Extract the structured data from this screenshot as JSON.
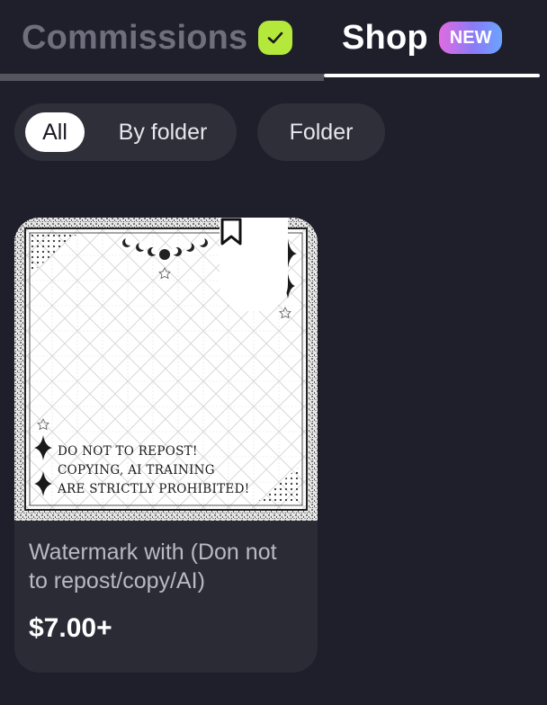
{
  "tabs": {
    "commissions": {
      "label": "Commissions",
      "icon": "check-icon",
      "badge_color": "#b4e83a"
    },
    "shop": {
      "label": "Shop",
      "badge": "NEW"
    }
  },
  "filters": {
    "all": "All",
    "by_folder": "By folder",
    "folder_button": "Folder"
  },
  "product": {
    "title": "Watermark with (Don not to repost/copy/AI)",
    "price": "$7.00+",
    "image_text": [
      "Do not to repost!",
      "copying, AI training",
      "are strictly prohibited!"
    ],
    "bookmark_icon": "bookmark-icon"
  },
  "colors": {
    "background": "#1f1f2b",
    "card": "#2b2b35",
    "pill": "#2f2f3a"
  }
}
